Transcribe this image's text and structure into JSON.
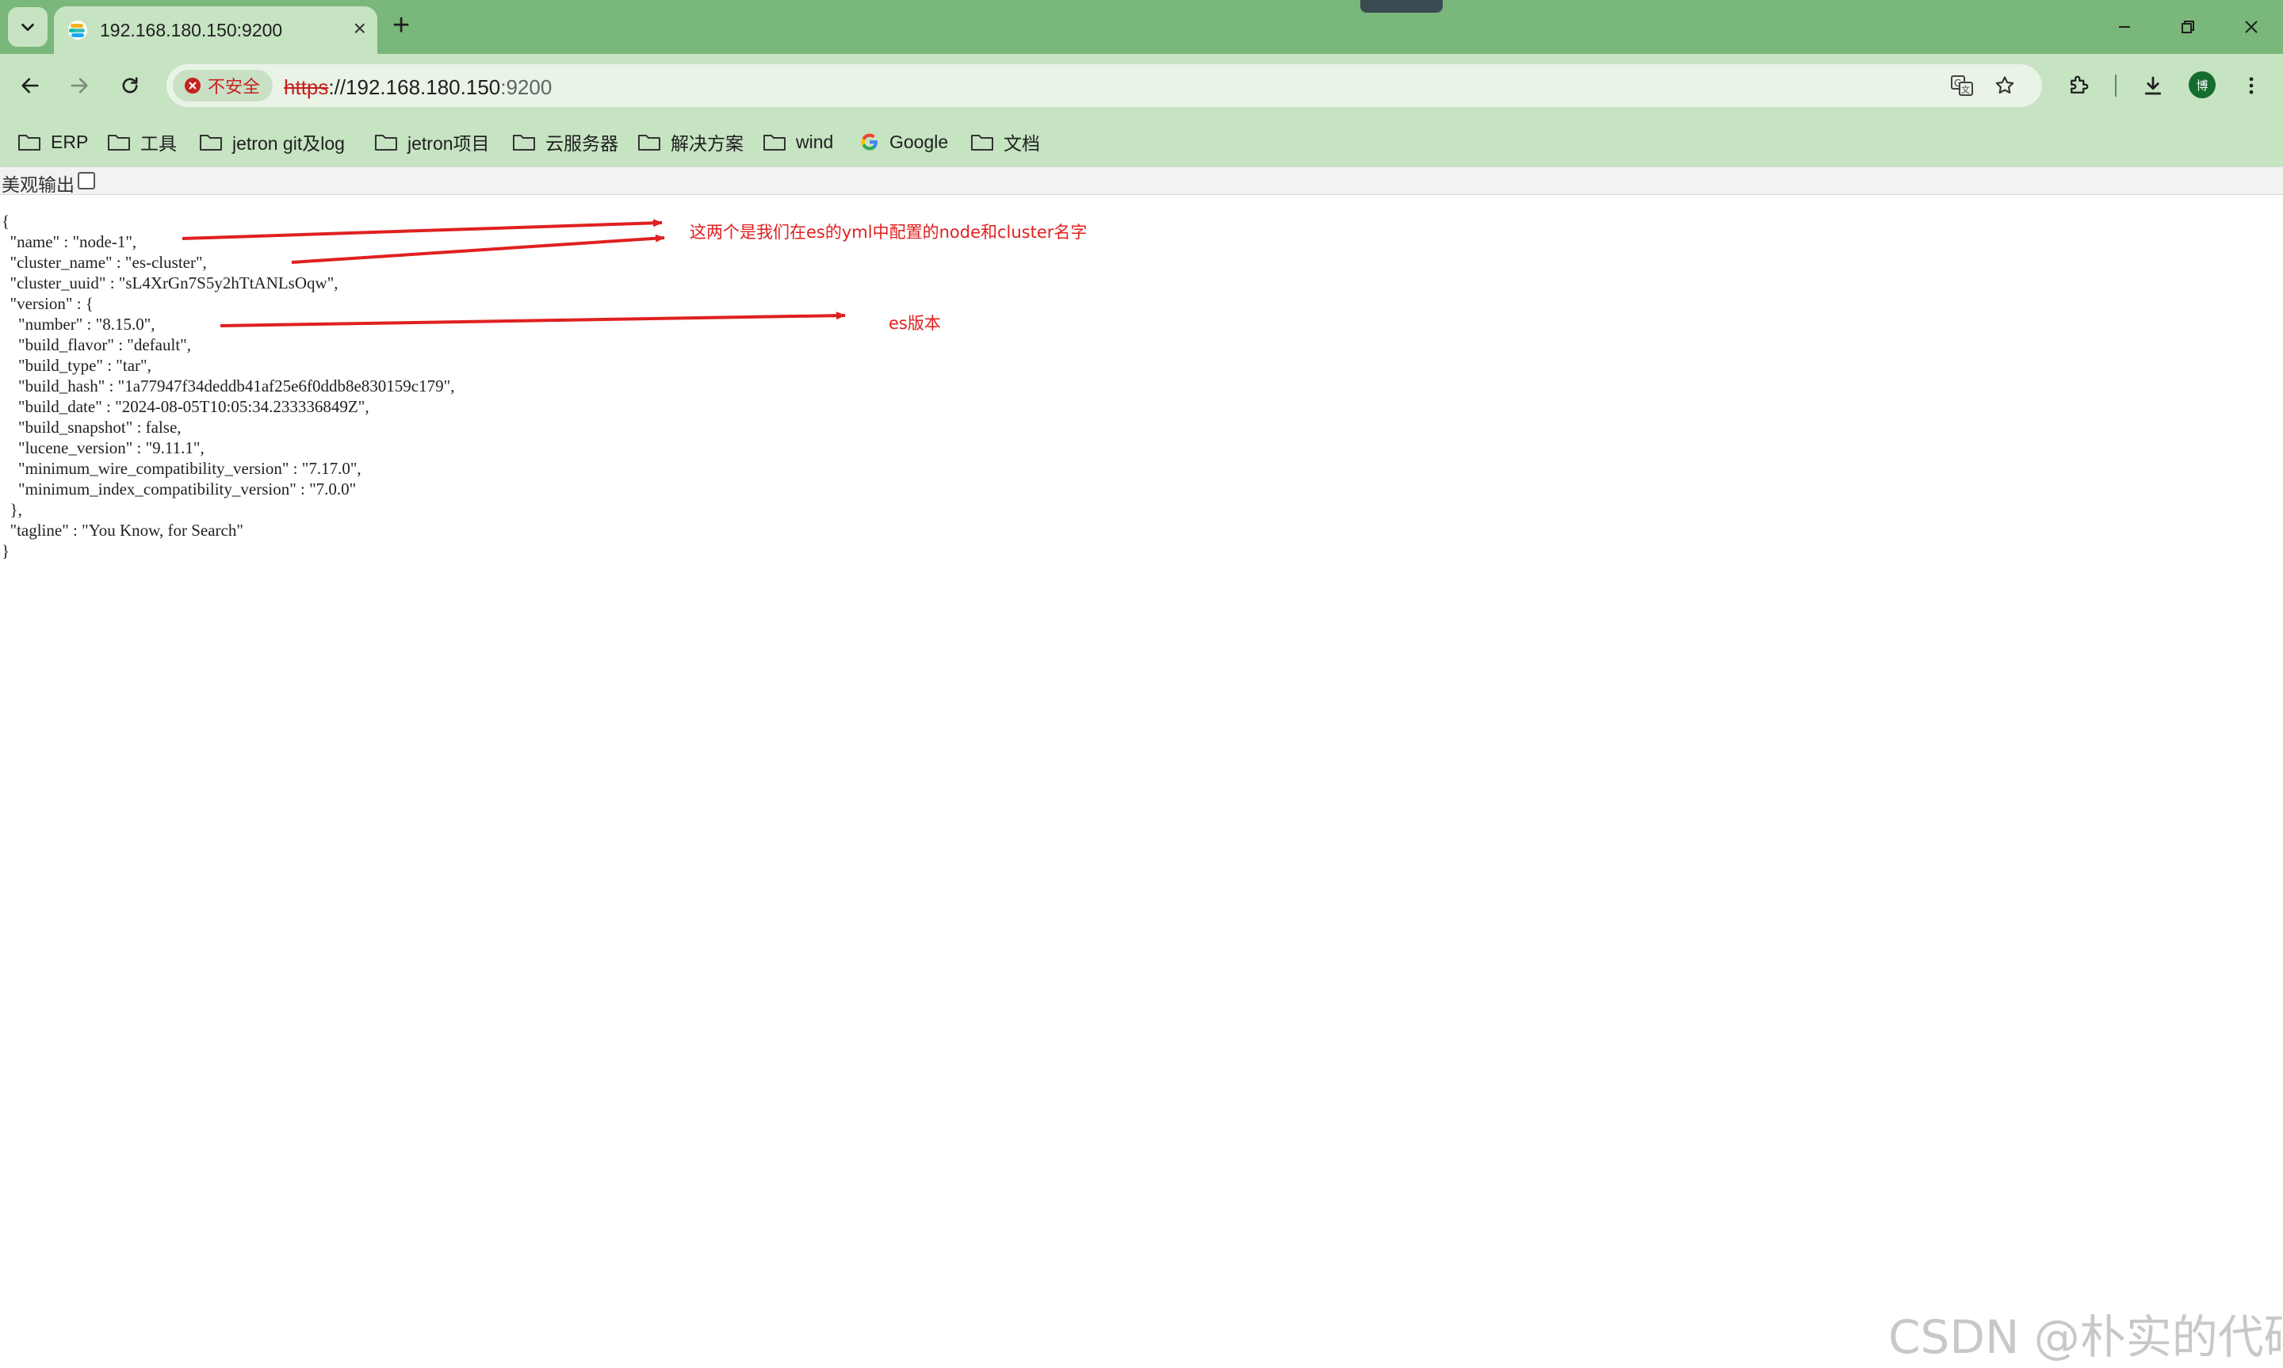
{
  "browser": {
    "tab": {
      "title": "192.168.180.150:9200"
    },
    "address": {
      "security_label": "不安全",
      "scheme": "https",
      "host": "://192.168.180.150",
      "port": ":9200"
    },
    "profile_initial": "博",
    "bookmarks": [
      {
        "label": "ERP",
        "icon": "folder-icon"
      },
      {
        "label": "工具",
        "icon": "folder-icon"
      },
      {
        "label": "jetron git及log",
        "icon": "folder-icon"
      },
      {
        "label": "jetron项目",
        "icon": "folder-icon"
      },
      {
        "label": "云服务器",
        "icon": "folder-icon"
      },
      {
        "label": "解决方案",
        "icon": "folder-icon"
      },
      {
        "label": "wind",
        "icon": "folder-icon"
      },
      {
        "label": "Google",
        "icon": "google-icon"
      },
      {
        "label": "文档",
        "icon": "folder-icon"
      }
    ]
  },
  "page": {
    "pretty_print_label": "美观输出",
    "json_lines": [
      "{",
      "  \"name\" : \"node-1\",",
      "  \"cluster_name\" : \"es-cluster\",",
      "  \"cluster_uuid\" : \"sL4XrGn7S5y2hTtANLsOqw\",",
      "  \"version\" : {",
      "    \"number\" : \"8.15.0\",",
      "    \"build_flavor\" : \"default\",",
      "    \"build_type\" : \"tar\",",
      "    \"build_hash\" : \"1a77947f34deddb41af25e6f0ddb8e830159c179\",",
      "    \"build_date\" : \"2024-08-05T10:05:34.233336849Z\",",
      "    \"build_snapshot\" : false,",
      "    \"lucene_version\" : \"9.11.1\",",
      "    \"minimum_wire_compatibility_version\" : \"7.17.0\",",
      "    \"minimum_index_compatibility_version\" : \"7.0.0\"",
      "  },",
      "  \"tagline\" : \"You Know, for Search\"",
      "}"
    ],
    "annotations": {
      "names_note": "这两个是我们在es的yml中配置的node和cluster名字",
      "version_note": "es版本"
    },
    "annotation_color": "#e02020",
    "watermark": "CSDN @朴实的代码"
  },
  "colors": {
    "titlebar": "#7ab77a",
    "toolbar": "#c6e3c2",
    "insecure": "#c5221f"
  }
}
